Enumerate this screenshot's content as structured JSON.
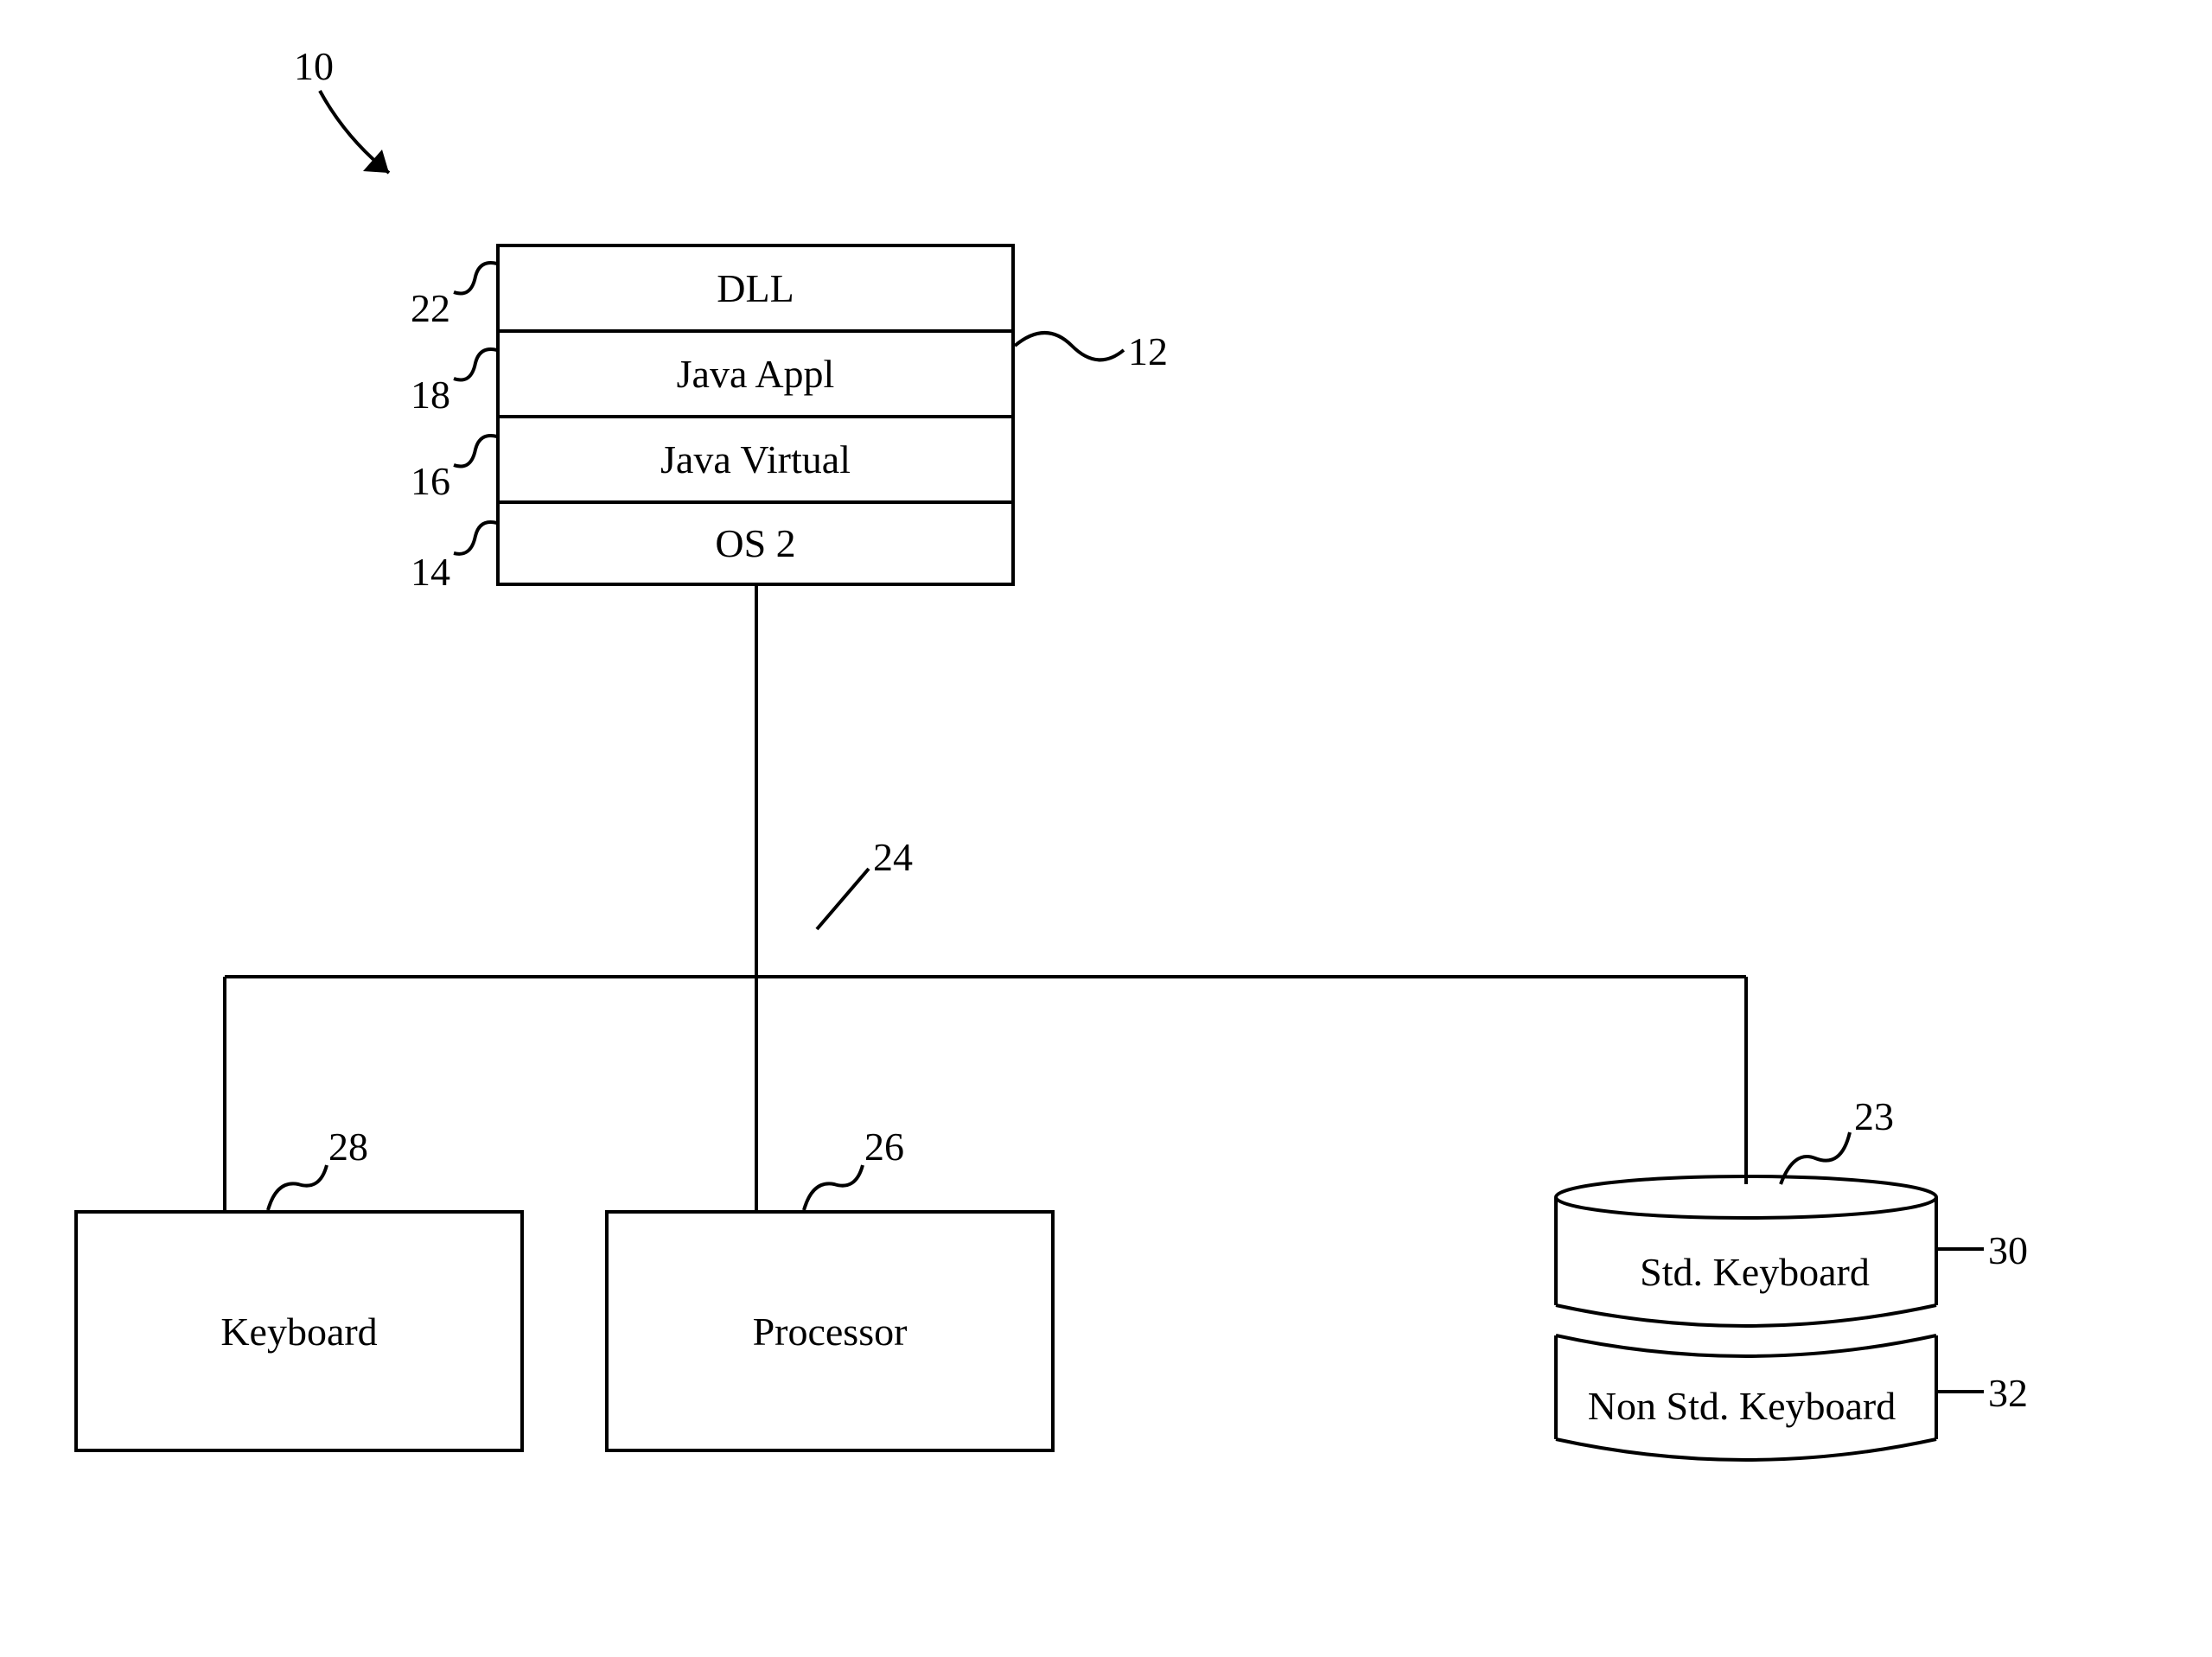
{
  "figure_ref": "10",
  "stack": {
    "dll": {
      "ref": "22",
      "label": "DLL"
    },
    "java_appl": {
      "ref": "18",
      "label": "Java Appl"
    },
    "java_virtual": {
      "ref": "16",
      "label": "Java Virtual"
    },
    "os2": {
      "ref": "14",
      "label": "OS 2"
    },
    "group_ref": "12"
  },
  "bus": {
    "ref": "24"
  },
  "keyboard": {
    "ref": "28",
    "label": "Keyboard"
  },
  "processor": {
    "ref": "26",
    "label": "Processor"
  },
  "storage": {
    "ref": "23",
    "std": {
      "ref": "30",
      "label": "Std. Keyboard"
    },
    "nonstd": {
      "ref": "32",
      "label": "Non Std. Keyboard"
    }
  }
}
